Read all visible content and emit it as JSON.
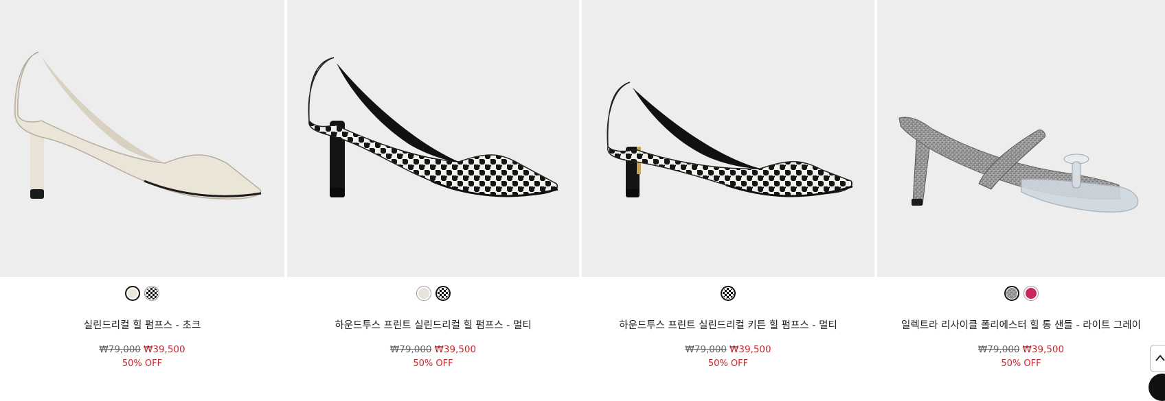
{
  "products": [
    {
      "name": "실린드리컬 힐 펌프스 - 초크",
      "original_price": "₩79,000",
      "sale_price": "₩39,500",
      "discount": "50% OFF",
      "swatches": [
        {
          "color": "#ece6dc",
          "pattern": "solid",
          "selected": true
        },
        {
          "color": "#222222",
          "pattern": "houndstooth",
          "selected": false
        }
      ]
    },
    {
      "name": "하운드투스 프린트 실린드리컬 힐 펌프스 - 멀티",
      "original_price": "₩79,000",
      "sale_price": "₩39,500",
      "discount": "50% OFF",
      "swatches": [
        {
          "color": "#e7e2da",
          "pattern": "solid",
          "selected": false
        },
        {
          "color": "#222222",
          "pattern": "houndstooth",
          "selected": true
        }
      ]
    },
    {
      "name": "하운드투스 프린트 실린드리컬 키튼 힐 펌프스 - 멀티",
      "original_price": "₩79,000",
      "sale_price": "₩39,500",
      "discount": "50% OFF",
      "swatches": [
        {
          "color": "#222222",
          "pattern": "houndstooth",
          "selected": true
        }
      ]
    },
    {
      "name": "일렉트라 리사이클 폴리에스터 힐 통 샌들 - 라이트 그레이",
      "original_price": "₩79,000",
      "sale_price": "₩39,500",
      "discount": "50% OFF",
      "swatches": [
        {
          "color": "#9a9a9a",
          "pattern": "solid",
          "selected": true
        },
        {
          "color": "#c8285a",
          "pattern": "solid",
          "selected": false
        }
      ]
    }
  ],
  "colors": {
    "image_bg": "#ededed",
    "sale_red": "#c8242b"
  },
  "floating": {
    "scroll_top_icon": "chevron-up-icon",
    "chat_icon": "chat-icon"
  }
}
